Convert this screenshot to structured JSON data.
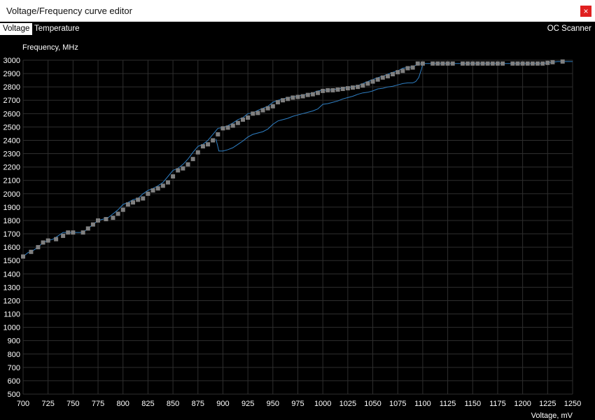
{
  "window": {
    "title": "Voltage/Frequency curve editor",
    "close_label": "×"
  },
  "toolbar": {
    "tabs": [
      "Voltage",
      "Temperature"
    ],
    "oc_scanner_label": "OC Scanner"
  },
  "colors": {
    "background": "#000000",
    "grid": "#2e2e2e",
    "curve": "#2f7fc4",
    "point": "#808080",
    "active_tab_bg": "#ffffff",
    "close_button": "#e02020"
  },
  "chart_data": {
    "type": "line",
    "ylabel": "Frequency, MHz",
    "xlabel": "Voltage, mV",
    "xlim": [
      700,
      1250
    ],
    "ylim": [
      500,
      3000
    ],
    "xticks": [
      700,
      725,
      750,
      775,
      800,
      825,
      850,
      875,
      900,
      925,
      950,
      975,
      1000,
      1025,
      1050,
      1075,
      1100,
      1125,
      1150,
      1175,
      1200,
      1225,
      1250
    ],
    "yticks": [
      500,
      600,
      700,
      800,
      900,
      1000,
      1100,
      1200,
      1300,
      1400,
      1500,
      1600,
      1700,
      1800,
      1900,
      2000,
      2100,
      2200,
      2300,
      2400,
      2500,
      2600,
      2700,
      2800,
      2900,
      3000
    ],
    "grid": true,
    "series": [
      {
        "values": [
          [
            700,
            1530
          ],
          [
            705,
            1560
          ],
          [
            710,
            1575
          ],
          [
            715,
            1600
          ],
          [
            720,
            1635
          ],
          [
            725,
            1650
          ],
          [
            730,
            1660
          ],
          [
            735,
            1685
          ],
          [
            740,
            1710
          ],
          [
            745,
            1710
          ],
          [
            750,
            1710
          ],
          [
            755,
            1710
          ],
          [
            760,
            1710
          ],
          [
            765,
            1740
          ],
          [
            770,
            1770
          ],
          [
            775,
            1800
          ],
          [
            780,
            1810
          ],
          [
            785,
            1820
          ],
          [
            790,
            1850
          ],
          [
            795,
            1880
          ],
          [
            800,
            1920
          ],
          [
            805,
            1935
          ],
          [
            810,
            1955
          ],
          [
            815,
            1965
          ],
          [
            820,
            2000
          ],
          [
            825,
            2025
          ],
          [
            830,
            2040
          ],
          [
            835,
            2060
          ],
          [
            840,
            2085
          ],
          [
            845,
            2130
          ],
          [
            850,
            2175
          ],
          [
            855,
            2190
          ],
          [
            860,
            2220
          ],
          [
            865,
            2260
          ],
          [
            870,
            2310
          ],
          [
            875,
            2355
          ],
          [
            880,
            2370
          ],
          [
            885,
            2400
          ],
          [
            890,
            2445
          ],
          [
            895,
            2490
          ],
          [
            900,
            2495
          ],
          [
            905,
            2510
          ],
          [
            910,
            2530
          ],
          [
            915,
            2555
          ],
          [
            920,
            2570
          ],
          [
            925,
            2600
          ],
          [
            930,
            2605
          ],
          [
            935,
            2625
          ],
          [
            940,
            2640
          ],
          [
            945,
            2655
          ],
          [
            950,
            2685
          ],
          [
            955,
            2700
          ],
          [
            960,
            2710
          ],
          [
            965,
            2720
          ],
          [
            970,
            2725
          ],
          [
            975,
            2730
          ],
          [
            980,
            2740
          ],
          [
            985,
            2745
          ],
          [
            990,
            2755
          ],
          [
            995,
            2770
          ],
          [
            1000,
            2775
          ],
          [
            1005,
            2775
          ],
          [
            1010,
            2780
          ],
          [
            1015,
            2785
          ],
          [
            1020,
            2790
          ],
          [
            1025,
            2795
          ],
          [
            1030,
            2800
          ],
          [
            1035,
            2810
          ],
          [
            1040,
            2825
          ],
          [
            1045,
            2840
          ],
          [
            1050,
            2855
          ],
          [
            1055,
            2870
          ],
          [
            1060,
            2880
          ],
          [
            1065,
            2895
          ],
          [
            1070,
            2910
          ],
          [
            1075,
            2920
          ],
          [
            1080,
            2940
          ],
          [
            1085,
            2945
          ],
          [
            1090,
            2950
          ],
          [
            1095,
            2970
          ],
          [
            1100,
            2975
          ],
          [
            1105,
            2975
          ],
          [
            1110,
            2975
          ],
          [
            1115,
            2975
          ],
          [
            1120,
            2975
          ],
          [
            1125,
            2975
          ],
          [
            1130,
            2975
          ],
          [
            1135,
            2975
          ],
          [
            1140,
            2975
          ],
          [
            1145,
            2975
          ],
          [
            1150,
            2975
          ],
          [
            1155,
            2975
          ],
          [
            1160,
            2975
          ],
          [
            1165,
            2975
          ],
          [
            1170,
            2975
          ],
          [
            1175,
            2975
          ],
          [
            1180,
            2975
          ],
          [
            1185,
            2975
          ],
          [
            1190,
            2975
          ],
          [
            1195,
            2975
          ],
          [
            1200,
            2975
          ],
          [
            1205,
            2975
          ],
          [
            1210,
            2975
          ],
          [
            1215,
            2975
          ],
          [
            1220,
            2975
          ],
          [
            1225,
            2980
          ],
          [
            1230,
            2985
          ],
          [
            1235,
            2990
          ],
          [
            1240,
            2990
          ],
          [
            1245,
            2990
          ],
          [
            1250,
            2990
          ]
        ]
      },
      {
        "values": [
          [
            893,
            2410
          ],
          [
            896,
            2320
          ],
          [
            900,
            2320
          ],
          [
            905,
            2330
          ],
          [
            910,
            2345
          ],
          [
            915,
            2370
          ],
          [
            920,
            2395
          ],
          [
            925,
            2425
          ],
          [
            930,
            2445
          ],
          [
            935,
            2455
          ],
          [
            940,
            2465
          ],
          [
            945,
            2485
          ],
          [
            950,
            2520
          ],
          [
            955,
            2545
          ],
          [
            960,
            2555
          ],
          [
            965,
            2565
          ],
          [
            970,
            2580
          ],
          [
            975,
            2590
          ],
          [
            980,
            2600
          ],
          [
            985,
            2610
          ],
          [
            990,
            2620
          ],
          [
            995,
            2635
          ],
          [
            1000,
            2670
          ],
          [
            1005,
            2675
          ],
          [
            1010,
            2685
          ],
          [
            1015,
            2695
          ],
          [
            1020,
            2710
          ],
          [
            1025,
            2720
          ],
          [
            1030,
            2730
          ],
          [
            1035,
            2745
          ],
          [
            1040,
            2755
          ],
          [
            1045,
            2760
          ],
          [
            1050,
            2770
          ],
          [
            1055,
            2785
          ],
          [
            1060,
            2790
          ],
          [
            1065,
            2800
          ],
          [
            1070,
            2805
          ],
          [
            1075,
            2815
          ],
          [
            1080,
            2825
          ],
          [
            1085,
            2830
          ],
          [
            1090,
            2830
          ],
          [
            1093,
            2840
          ],
          [
            1096,
            2870
          ],
          [
            1099,
            2940
          ],
          [
            1100,
            2975
          ]
        ]
      }
    ],
    "markers": [
      [
        700,
        1530
      ],
      [
        708,
        1565
      ],
      [
        715,
        1600
      ],
      [
        720,
        1635
      ],
      [
        725,
        1650
      ],
      [
        733,
        1660
      ],
      [
        740,
        1685
      ],
      [
        745,
        1710
      ],
      [
        750,
        1710
      ],
      [
        760,
        1710
      ],
      [
        765,
        1740
      ],
      [
        770,
        1770
      ],
      [
        775,
        1800
      ],
      [
        783,
        1810
      ],
      [
        790,
        1820
      ],
      [
        795,
        1850
      ],
      [
        800,
        1880
      ],
      [
        805,
        1920
      ],
      [
        810,
        1935
      ],
      [
        815,
        1955
      ],
      [
        820,
        1965
      ],
      [
        825,
        2000
      ],
      [
        830,
        2025
      ],
      [
        835,
        2040
      ],
      [
        840,
        2060
      ],
      [
        845,
        2085
      ],
      [
        850,
        2130
      ],
      [
        855,
        2175
      ],
      [
        860,
        2190
      ],
      [
        865,
        2220
      ],
      [
        870,
        2260
      ],
      [
        875,
        2310
      ],
      [
        880,
        2355
      ],
      [
        885,
        2370
      ],
      [
        890,
        2400
      ],
      [
        895,
        2445
      ],
      [
        900,
        2490
      ],
      [
        905,
        2495
      ],
      [
        910,
        2510
      ],
      [
        915,
        2530
      ],
      [
        920,
        2555
      ],
      [
        925,
        2570
      ],
      [
        930,
        2600
      ],
      [
        935,
        2605
      ],
      [
        940,
        2625
      ],
      [
        945,
        2640
      ],
      [
        950,
        2655
      ],
      [
        955,
        2685
      ],
      [
        960,
        2700
      ],
      [
        965,
        2710
      ],
      [
        970,
        2720
      ],
      [
        975,
        2725
      ],
      [
        980,
        2730
      ],
      [
        985,
        2740
      ],
      [
        990,
        2745
      ],
      [
        995,
        2755
      ],
      [
        1000,
        2770
      ],
      [
        1005,
        2775
      ],
      [
        1010,
        2775
      ],
      [
        1015,
        2780
      ],
      [
        1020,
        2785
      ],
      [
        1025,
        2790
      ],
      [
        1030,
        2795
      ],
      [
        1035,
        2800
      ],
      [
        1040,
        2810
      ],
      [
        1045,
        2825
      ],
      [
        1050,
        2840
      ],
      [
        1055,
        2855
      ],
      [
        1060,
        2870
      ],
      [
        1065,
        2880
      ],
      [
        1070,
        2895
      ],
      [
        1075,
        2910
      ],
      [
        1080,
        2920
      ],
      [
        1085,
        2940
      ],
      [
        1090,
        2945
      ],
      [
        1095,
        2975
      ],
      [
        1100,
        2975
      ],
      [
        1110,
        2975
      ],
      [
        1115,
        2975
      ],
      [
        1120,
        2975
      ],
      [
        1125,
        2975
      ],
      [
        1130,
        2975
      ],
      [
        1140,
        2975
      ],
      [
        1145,
        2975
      ],
      [
        1150,
        2975
      ],
      [
        1155,
        2975
      ],
      [
        1160,
        2975
      ],
      [
        1165,
        2975
      ],
      [
        1170,
        2975
      ],
      [
        1175,
        2975
      ],
      [
        1180,
        2975
      ],
      [
        1190,
        2975
      ],
      [
        1195,
        2975
      ],
      [
        1200,
        2975
      ],
      [
        1205,
        2975
      ],
      [
        1210,
        2975
      ],
      [
        1215,
        2975
      ],
      [
        1220,
        2975
      ],
      [
        1225,
        2980
      ],
      [
        1230,
        2985
      ],
      [
        1240,
        2990
      ]
    ]
  }
}
